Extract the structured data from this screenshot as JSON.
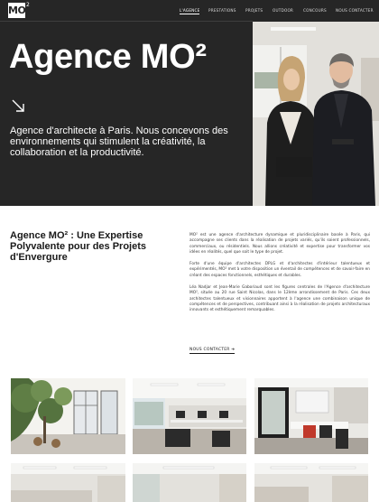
{
  "header": {
    "logo_text": "MO",
    "logo_sup": "2",
    "nav": [
      {
        "label": "L'AGENCE",
        "active": true
      },
      {
        "label": "PRESTATIONS",
        "active": false
      },
      {
        "label": "PROJETS",
        "active": false
      },
      {
        "label": "OUTDOOR",
        "active": false
      },
      {
        "label": "CONCOURS",
        "active": false
      },
      {
        "label": "NOUS CONTACTER",
        "active": false
      }
    ]
  },
  "hero": {
    "title": "Agence MO²",
    "subtitle": "Agence d'architecte à Paris. Nous concevons des environnements qui stimulent la créativité, la collaboration et la productivité.",
    "arrow_icon": "arrow-down-right-icon"
  },
  "intro": {
    "title": "Agence MO² : Une Expertise Polyvalente pour des Projets d'Envergure",
    "paragraphs": [
      "MO² est une agence d'architecture dynamique et pluridisciplinaire basée à Paris, qui accompagne ses clients dans la réalisation de projets variés, qu'ils soient professionnels, commerciaux, ou résidentiels. Nous allions créativité et expertise pour transformer vos idées en réalités, quel que soit le type de projet.",
      "Forte d'une équipe d'architectes DPLG et d'architectes d'intérieur talentueux et expérimentés, MO² met à votre disposition un éventail de compétences et de savoir-faire en créant des espaces fonctionnels, esthétiques et durables.",
      "Léa Nadjar et Jean-Marie Gaboriaud sont les figures centrales de l'Agence d'architecture MO², située au 20 rue Saint Nicolas, dans le 12ème arrondissement de Paris. Ces deux architectes talentueux et visionnaires apportent à l'agence une combinaison unique de compétences et de perspectives, contribuant ainsi à la réalisation de projets architecturaux innovants et esthétiquement remarquables."
    ],
    "contact_label": "NOUS CONTACTER ➔"
  },
  "colors": {
    "hero_bg": "#262626",
    "text_dark": "#1a1a1a",
    "white": "#ffffff"
  }
}
